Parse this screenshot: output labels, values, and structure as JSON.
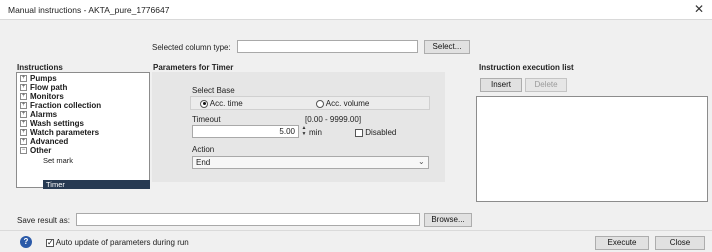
{
  "window": {
    "title": "Manual instructions - AKTA_pure_1776647",
    "close_glyph": "✕"
  },
  "column_type": {
    "label": "Selected column type:",
    "value": "",
    "select_label": "Select..."
  },
  "instructions": {
    "heading": "Instructions",
    "tree": [
      {
        "label": "Pumps",
        "expander": "+"
      },
      {
        "label": "Flow path",
        "expander": "+"
      },
      {
        "label": "Monitors",
        "expander": "+"
      },
      {
        "label": "Fraction collection",
        "expander": "+"
      },
      {
        "label": "Alarms",
        "expander": "+"
      },
      {
        "label": "Wash settings",
        "expander": "+"
      },
      {
        "label": "Watch parameters",
        "expander": "+"
      },
      {
        "label": "Advanced",
        "expander": "+"
      },
      {
        "label": "Other",
        "expander": "−",
        "children": [
          "Set mark",
          "Timer"
        ],
        "selected_child": "Timer"
      }
    ]
  },
  "parameters": {
    "heading": "Parameters for Timer",
    "select_base_label": "Select Base",
    "base_options": [
      "Acc. time",
      "Acc. volume"
    ],
    "base_selected": "Acc. time",
    "timeout_label": "Timeout",
    "timeout_range": "[0.00 - 9999.00]",
    "timeout_value": "5.00",
    "timeout_unit": "min",
    "disabled_label": "Disabled",
    "disabled_checked": false,
    "action_label": "Action",
    "action_value": "End"
  },
  "execution": {
    "heading": "Instruction execution list",
    "insert_label": "Insert",
    "delete_label": "Delete"
  },
  "save_result": {
    "label": "Save result as:",
    "value": "",
    "browse_label": "Browse..."
  },
  "footer": {
    "help_glyph": "?",
    "auto_update_label": "Auto update of parameters during run",
    "auto_update_checked": true,
    "execute_label": "Execute",
    "close_label": "Close"
  }
}
